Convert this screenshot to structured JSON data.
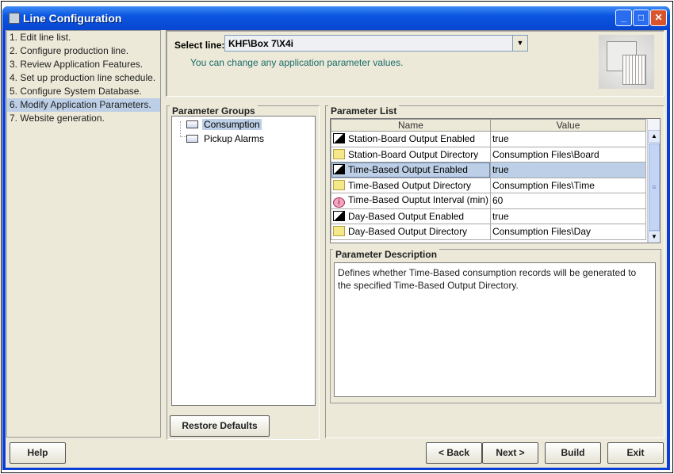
{
  "window": {
    "title": "Line Configuration"
  },
  "steps": [
    "1. Edit line list.",
    "2. Configure production line.",
    "3. Review Application Features.",
    "4. Set up production line schedule.",
    "5. Configure System Database.",
    "6. Modify Application Parameters.",
    "7. Website generation."
  ],
  "selected_step": 5,
  "select_line": {
    "label": "Select line:",
    "value": "KHF\\Box 7\\X4i",
    "hint": "You can change any application parameter values."
  },
  "parameter_groups": {
    "title": "Parameter Groups",
    "items": [
      "Consumption",
      "Pickup Alarms"
    ]
  },
  "parameter_list": {
    "title": "Parameter List",
    "columns": [
      "Name",
      "Value"
    ],
    "rows": [
      {
        "icon": "boolean-icon",
        "name": "Station-Board Output Enabled",
        "value": "true"
      },
      {
        "icon": "folder-icon",
        "name": "Station-Board Output Directory",
        "value": "Consumption Files\\Board"
      },
      {
        "icon": "boolean-icon",
        "name": "Time-Based Output Enabled",
        "value": "true"
      },
      {
        "icon": "folder-icon",
        "name": "Time-Based Output Directory",
        "value": "Consumption Files\\Time"
      },
      {
        "icon": "info-icon",
        "name": "Time-Based Ouptut Interval (min)",
        "value": "60"
      },
      {
        "icon": "boolean-icon",
        "name": "Day-Based Output Enabled",
        "value": "true"
      },
      {
        "icon": "folder-icon",
        "name": "Day-Based Output Directory",
        "value": "Consumption Files\\Day"
      }
    ]
  },
  "parameter_description": {
    "title": "Parameter Description",
    "text": "Defines whether Time-Based consumption records will be generated to the specified Time-Based Output Directory."
  },
  "buttons": {
    "restore": "Restore Defaults",
    "help": "Help",
    "back": "< Back",
    "next": "Next >",
    "build": "Build",
    "exit": "Exit"
  }
}
